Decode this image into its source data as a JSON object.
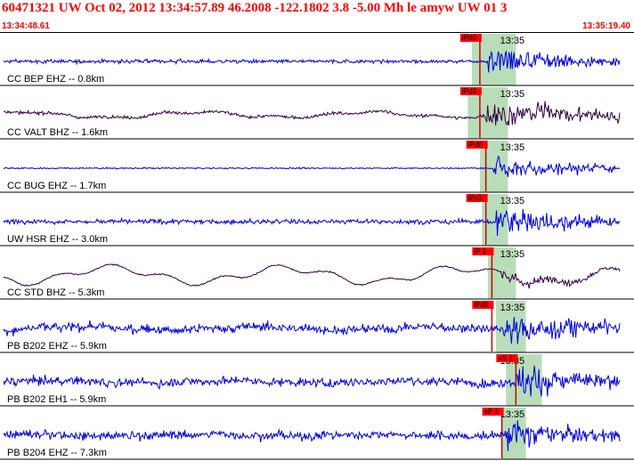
{
  "header": {
    "title": "60471321 UW Oct 02, 2012 13:34:57.89    46.2008 -122.1802  3.8 -5.00 Mh le amyw UW 01    3",
    "time_start": "13:34:48.61",
    "time_end": "13:35:19.40",
    "text_color": "#ff0000"
  },
  "chart_data": {
    "type": "line",
    "x_unit": "time",
    "xlim": [
      "13:34:48.61",
      "13:35:19.40"
    ],
    "minute_marker": "13:35",
    "grid": false,
    "colors": {
      "trace_blue": "#0000dd",
      "trace_dark": "#330044",
      "pick_box": "#ff0000",
      "window": "#b9ddb9",
      "pick_line": "#cc0000"
    },
    "series": [
      {
        "name": "CC BEP EHZ -- 0.8km",
        "pick": "iPd0",
        "pick_seconds": 23.8,
        "window_seconds": [
          23.4,
          25.6
        ],
        "onset_seconds": 24.2,
        "color": "blue",
        "noise": 0.22,
        "burst": 1.9,
        "decay": 3.5,
        "wave": 0
      },
      {
        "name": "CC VALT BHZ -- 1.6km",
        "pick": "iPd0",
        "pick_seconds": 23.8,
        "window_seconds": [
          23.2,
          25.2
        ],
        "onset_seconds": 24.1,
        "color": "dark",
        "noise": 0.18,
        "burst": 1.5,
        "decay": 5.5,
        "wave": 0.35
      },
      {
        "name": "CC BUG EHZ -- 1.7km",
        "pick": "iPd0",
        "pick_seconds": 24.1,
        "window_seconds": [
          23.8,
          25.2
        ],
        "onset_seconds": 24.5,
        "color": "blue",
        "noise": 0.08,
        "burst": 1.4,
        "decay": 4.5,
        "wave": 0
      },
      {
        "name": "UW HSR EHZ -- 3.0km",
        "pick": "iPc0",
        "pick_seconds": 24.1,
        "window_seconds": [
          23.9,
          25.2
        ],
        "onset_seconds": 24.6,
        "color": "blue",
        "noise": 0.28,
        "burst": 1.6,
        "decay": 4.0,
        "wave": 0
      },
      {
        "name": "CC STD BHZ -- 5.3km",
        "pick": "iP 1",
        "pick_seconds": 24.4,
        "window_seconds": [
          24.2,
          25.6
        ],
        "onset_seconds": 24.8,
        "color": "dark",
        "noise": 0.07,
        "burst": 0.9,
        "decay": 3.0,
        "wave": 1.0
      },
      {
        "name": "PB B202 EHZ -- 5.9km",
        "pick": "iPd0",
        "pick_seconds": 24.4,
        "window_seconds": [
          24.6,
          26.1
        ],
        "onset_seconds": 24.9,
        "color": "blue",
        "noise": 0.55,
        "burst": 1.3,
        "decay": 3.5,
        "wave": 0.2
      },
      {
        "name": "PB B202 EH1 -- 5.9km",
        "pick": "eS 1",
        "pick_seconds": 25.6,
        "window_seconds": [
          25.1,
          26.9
        ],
        "onset_seconds": 25.6,
        "color": "blue",
        "noise": 0.5,
        "burst": 1.6,
        "decay": 3.0,
        "wave": 0.15
      },
      {
        "name": "PB B204 EHZ -- 7.3km",
        "pick": "eP 2",
        "pick_seconds": 24.9,
        "window_seconds": [
          24.9,
          26.1
        ],
        "onset_seconds": 25.1,
        "color": "blue",
        "noise": 0.5,
        "burst": 1.3,
        "decay": 3.0,
        "wave": 0.1
      }
    ]
  }
}
